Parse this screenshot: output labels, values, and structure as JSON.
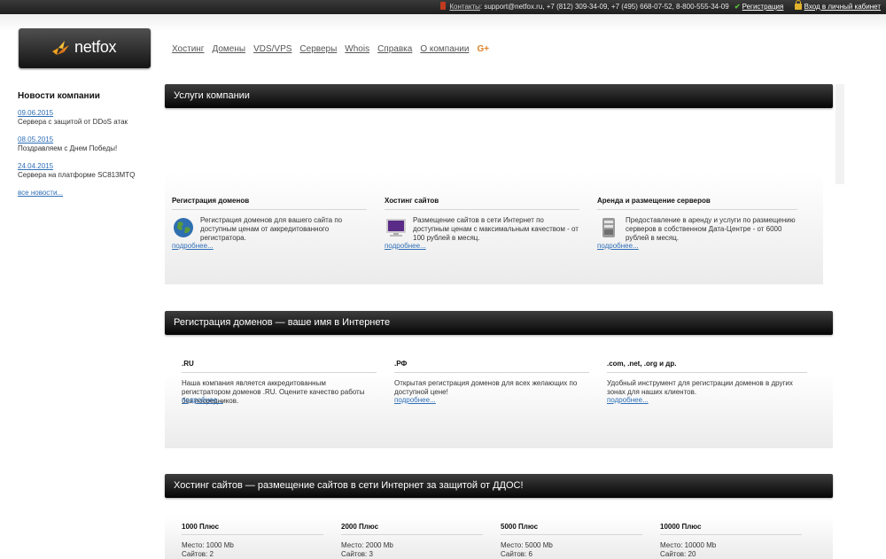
{
  "topbar": {
    "contacts_label": "Контакты",
    "contacts_text": ": support@netfox.ru, +7 (812) 309-34-09, +7 (495) 668-07-52, 8-800-555-34-09",
    "register_label": "Регистрация",
    "login_label": "Вход в личный кабинет"
  },
  "logo": {
    "text": "netfox"
  },
  "nav": {
    "items": [
      "Хостинг",
      "Домены",
      "VDS/VPS",
      "Серверы",
      "Whois",
      "Справка",
      "О компании"
    ],
    "gplus": "G+"
  },
  "sidebar": {
    "heading": "Новости компании",
    "news": [
      {
        "date": "09.06.2015",
        "text": "Сервера с защитой от DDoS атак"
      },
      {
        "date": "08.05.2015",
        "text": "Поздравляем с Днем Победы!"
      },
      {
        "date": "24.04.2015",
        "text": "Сервера на платформе SC813MTQ"
      }
    ],
    "all_news": "все новости..."
  },
  "services": {
    "header": "Услуги компании",
    "items": [
      {
        "title": "Регистрация доменов",
        "desc": "Регистрация доменов для вашего сайта по доступным ценам от аккредитованного регистратора.",
        "more": "подробнее...",
        "icon": "globe-icon"
      },
      {
        "title": "Хостинг сайтов",
        "desc": "Размещение сайтов в сети Интернет по доступным ценам с максимальным качеством - от 100 рублей в месяц.",
        "more": "подробнее...",
        "icon": "monitor-icon"
      },
      {
        "title": "Аренда и размещение серверов",
        "desc": "Предоставление в аренду и услуги по размещению серверов в собственном Дата-Центре - от 6000 рублей в месяц.",
        "more": "подробнее...",
        "icon": "server-icon"
      }
    ]
  },
  "domains": {
    "header": "Регистрация доменов — ваше имя в Интернете",
    "items": [
      {
        "title": ".RU",
        "desc": "Наша компания является аккредитованным регистратором доменов .RU. Оцените качество работы без посредников.",
        "more": "подробнее..."
      },
      {
        "title": ".РФ",
        "desc": "Открытая регистрация доменов для всех желающих по доступной цене!",
        "more": "подробнее..."
      },
      {
        "title": ".com, .net, .org и др.",
        "desc": "Удобный инструмент для регистрации доменов в других зонах для наших клиентов.",
        "more": "подробнее..."
      }
    ]
  },
  "hosting": {
    "header": "Хостинг сайтов — размещение сайтов в сети Интернет за защитой от ДДОС!",
    "plans": [
      {
        "name": "1000 Плюс",
        "space": "Место: 1000 Mb",
        "sites": "Сайтов: 2"
      },
      {
        "name": "2000 Плюс",
        "space": "Место: 2000 Mb",
        "sites": "Сайтов: 3"
      },
      {
        "name": "5000 Плюс",
        "space": "Место: 5000 Mb",
        "sites": "Сайтов: 6"
      },
      {
        "name": "10000 Плюс",
        "space": "Место: 10000 Mb",
        "sites": "Сайтов: 20"
      }
    ]
  }
}
